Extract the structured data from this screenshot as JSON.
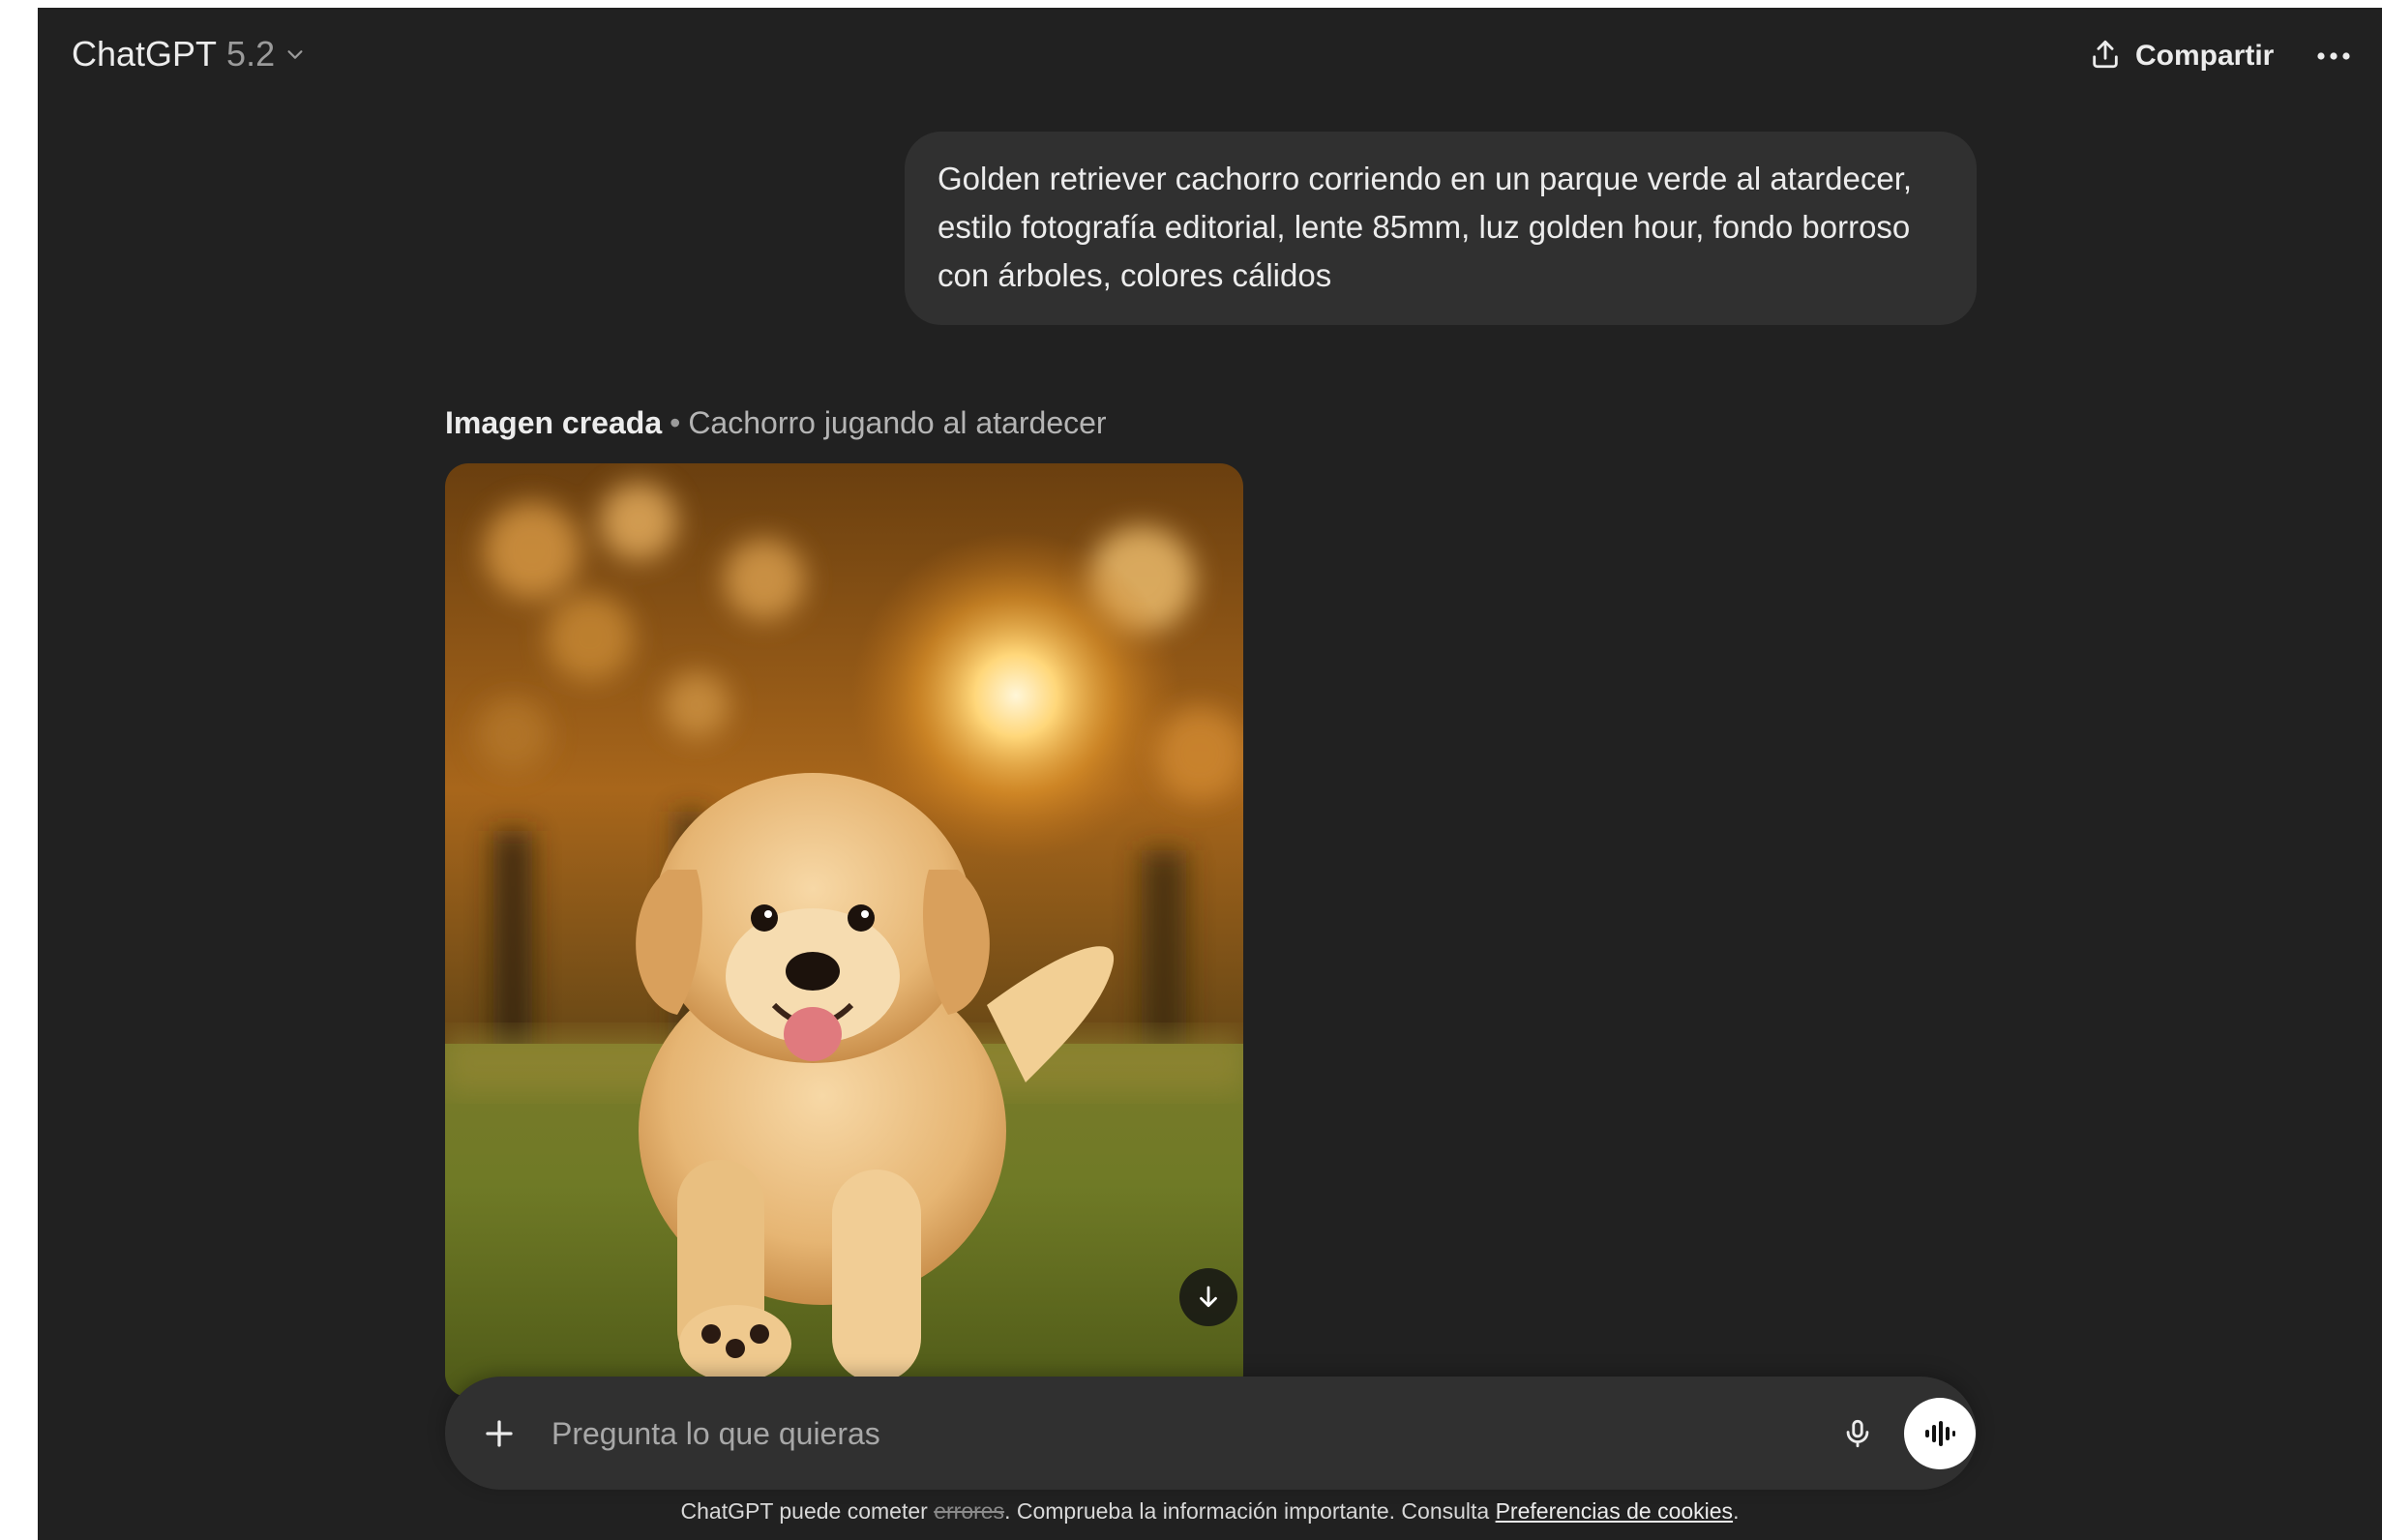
{
  "header": {
    "model_name": "ChatGPT",
    "model_version": "5.2",
    "share_label": "Compartir",
    "icons": {
      "model_dropdown": "chevron-down-icon",
      "share": "share-upload-icon",
      "more": "more-horizontal-icon"
    }
  },
  "conversation": {
    "user_message": "Golden retriever cachorro corriendo en un parque verde al atardecer, estilo fotografía editorial, lente 85mm, luz golden hour, fondo borroso con árboles, colores cálidos",
    "image_result": {
      "label": "Imagen creada",
      "separator": "•",
      "title": "Cachorro jugando al atardecer",
      "download_icon": "download-arrow-icon"
    }
  },
  "composer": {
    "placeholder": "Pregunta lo que quieras",
    "icons": {
      "attach": "plus-icon",
      "dictate": "microphone-icon",
      "voice": "voice-waveform-icon"
    }
  },
  "footer": {
    "disclaimer_start": "ChatGPT puede cometer",
    "disclaimer_struck": "errores",
    "disclaimer_middle": ". Comprueba la información importante. Consulta",
    "link_text": "Preferencias de cookies",
    "disclaimer_end": "."
  },
  "colors": {
    "background": "#212121",
    "bubble": "#303030",
    "text": "#ececec",
    "muted_text": "#9b9b9b"
  }
}
